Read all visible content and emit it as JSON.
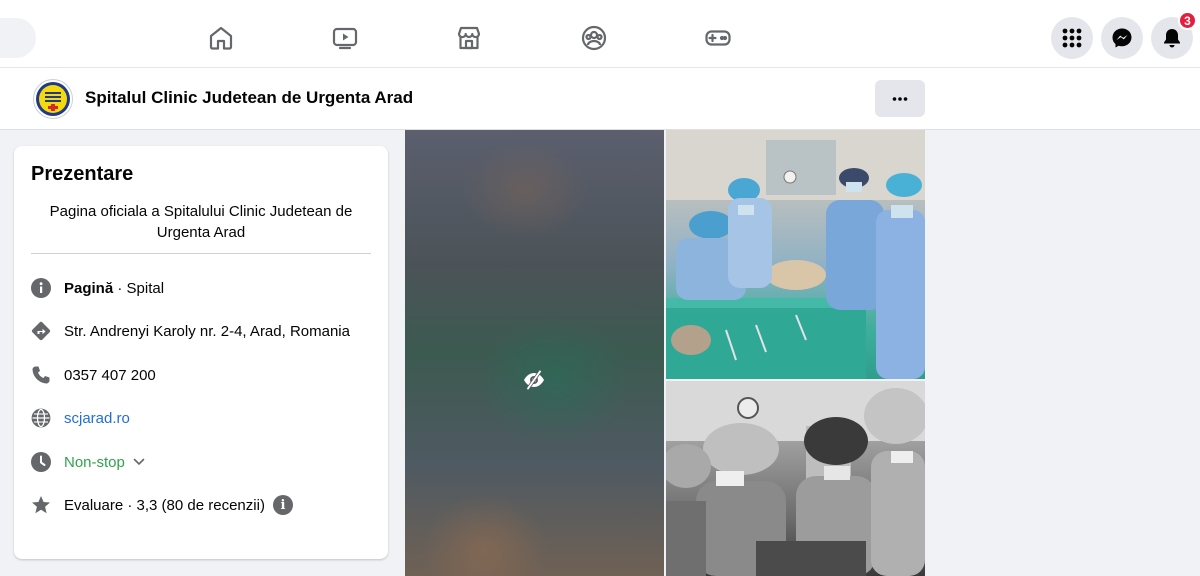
{
  "topnav": {
    "tabs": [
      {
        "icon": "home-icon"
      },
      {
        "icon": "video-icon"
      },
      {
        "icon": "marketplace-icon"
      },
      {
        "icon": "groups-icon"
      },
      {
        "icon": "gaming-icon"
      }
    ],
    "notification_count": "3"
  },
  "page": {
    "name": "Spitalul Clinic Judetean de Urgenta Arad",
    "more_label": "···"
  },
  "intro": {
    "title": "Prezentare",
    "description": "Pagina oficiala a Spitalului Clinic Judetean de Urgenta Arad",
    "category_label": "Pagină",
    "category_sep": " · ",
    "category_value": "Spital",
    "address": "Str. Andrenyi Karoly nr. 2-4, Arad, Romania",
    "phone": "0357 407 200",
    "website": "scjarad.ro",
    "hours": "Non-stop",
    "rating": "Evaluare · 3,3 (80 de recenzii)",
    "rating_info": "i"
  },
  "colors": {
    "link": "#216fdb",
    "open_status": "#31a24c",
    "notification_badge": "#e41e3f",
    "icon_gray": "#65676b"
  }
}
